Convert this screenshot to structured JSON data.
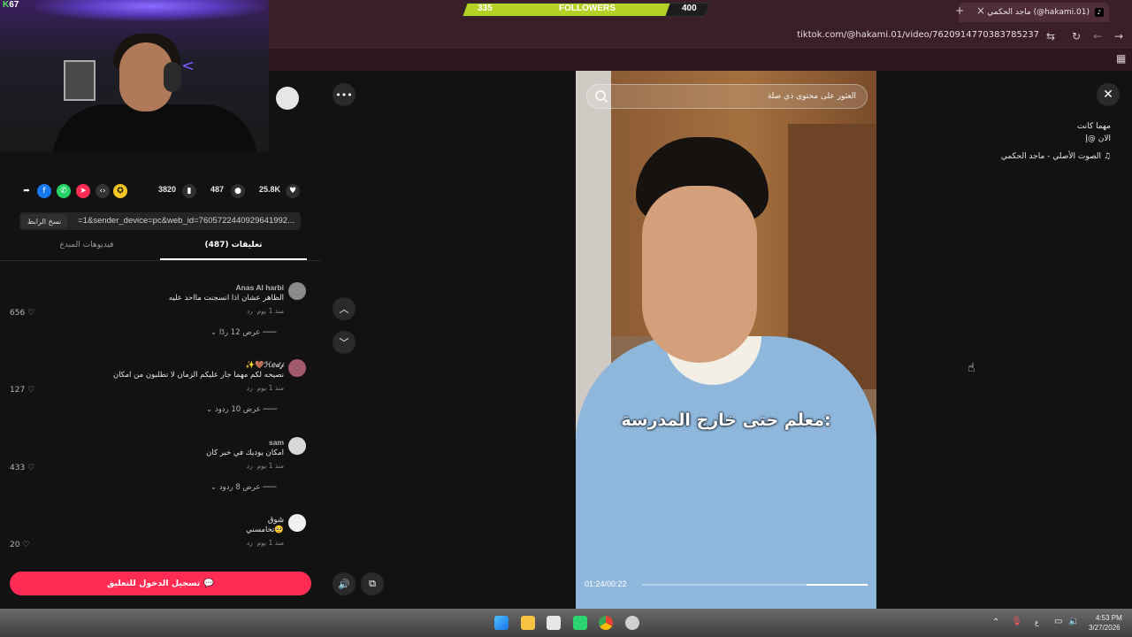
{
  "browser": {
    "tab_title": "ماجد الحكمي (@hakami.01)",
    "url": "tiktok.com/@hakami.01/video/7620914770383785237",
    "new_tab": "+",
    "tab_close": "×"
  },
  "stream_overlay": {
    "goal_current": "335",
    "goal_label": "FOLLOWERS",
    "goal_target": "400",
    "goal_progress": 0.84,
    "cam_logo_letter": "K",
    "cam_logo_number": "67"
  },
  "post": {
    "description_line1": "مهما كانت",
    "description_line2": "الان @إ",
    "sound": "الصوت الأصلي - ماجد الحكمي",
    "likes": "25.8K",
    "comments_count": "487",
    "saves": "3820",
    "share_link": "=1&sender_device=pc&web_id=7605722440929641992...",
    "copy_link_label": "نسخ الرابط"
  },
  "tabs": {
    "comments": "تعليقات (487)",
    "creator_videos": "فيديوهات المبدع"
  },
  "comments": [
    {
      "user": "Anas Al harbi",
      "text": "الظاهر عشان اذا انسجنت مااحد عليه",
      "time": "منذ 1 يوم",
      "reply": "رد",
      "likes": "656",
      "replies": "عرض 12 ردًا"
    },
    {
      "user": "✨🤎ℋℯ𝒹𝒿",
      "text": "نصيحه لكم مهما جار عليكم الزمان لا تطلبون من امكان",
      "time": "منذ 1 يوم",
      "reply": "رد",
      "likes": "127",
      "replies": "عرض 10 ردود"
    },
    {
      "user": "sam",
      "text": "امكان يوديك في خبر كان",
      "time": "منذ 1 يوم",
      "reply": "رد",
      "likes": "433",
      "replies": "عرض 8 ردود"
    },
    {
      "user": "شوق",
      "text": "تخامسني🥺",
      "time": "منذ 1 يوم",
      "reply": "رد",
      "likes": "20",
      "replies": ""
    }
  ],
  "login_button": "تسجيل الدخول للتعليق",
  "video": {
    "search_placeholder": "العثور على محتوى ذي صلة",
    "caption": "معلم حتى خارج المدرسة:",
    "time": "01:24/00:22",
    "progress": 0.27
  },
  "taskbar": {
    "time": "4:53 PM",
    "date": "3/27/2026",
    "lang": "ع"
  },
  "colors": {
    "accent": "#fe2c55",
    "goal_fill": "#b4d125",
    "browser_chrome": "#3a1f28"
  }
}
